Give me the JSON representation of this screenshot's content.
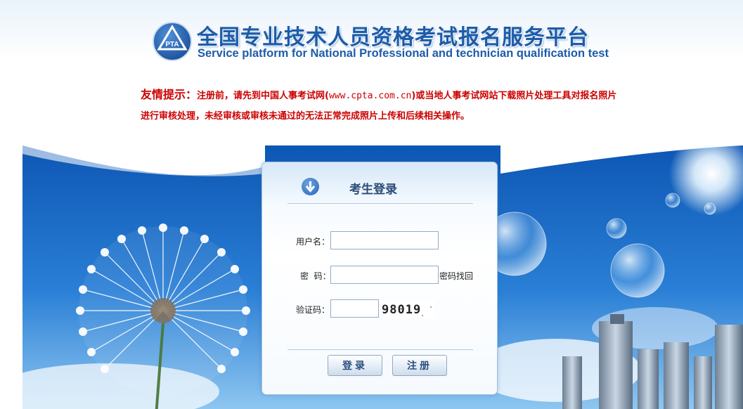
{
  "header": {
    "title_cn": "全国专业技术人员资格考试报名服务平台",
    "title_en": "Service platform for National Professional and technician qualification test",
    "logo_text": "PTA"
  },
  "notice": {
    "lead": "友情提示：",
    "text_before_url": "注册前，请先到中国人事考试网(",
    "url": "www.cpta.com.cn",
    "text_after_url": ")或当地人事考试网站下载照片处理工具对报名照片进行审核处理，未经审核或审核未通过的无法正常完成照片上传和后续相关操作。"
  },
  "login": {
    "title": "考生登录",
    "username_label": "用户名：",
    "username_value": "",
    "password_label": "密  码：",
    "password_value": "",
    "forgot_link": "密码找回",
    "captcha_label": "验证码：",
    "captcha_value": "",
    "captcha_text": "98019",
    "login_button": "登录",
    "register_button": "注册"
  },
  "colors": {
    "brand_blue": "#1d5ca8",
    "notice_red": "#cc0000",
    "sky_blue": "#1f6dc4"
  },
  "icons": {
    "panel_icon": "arrow-down-circle-icon"
  }
}
